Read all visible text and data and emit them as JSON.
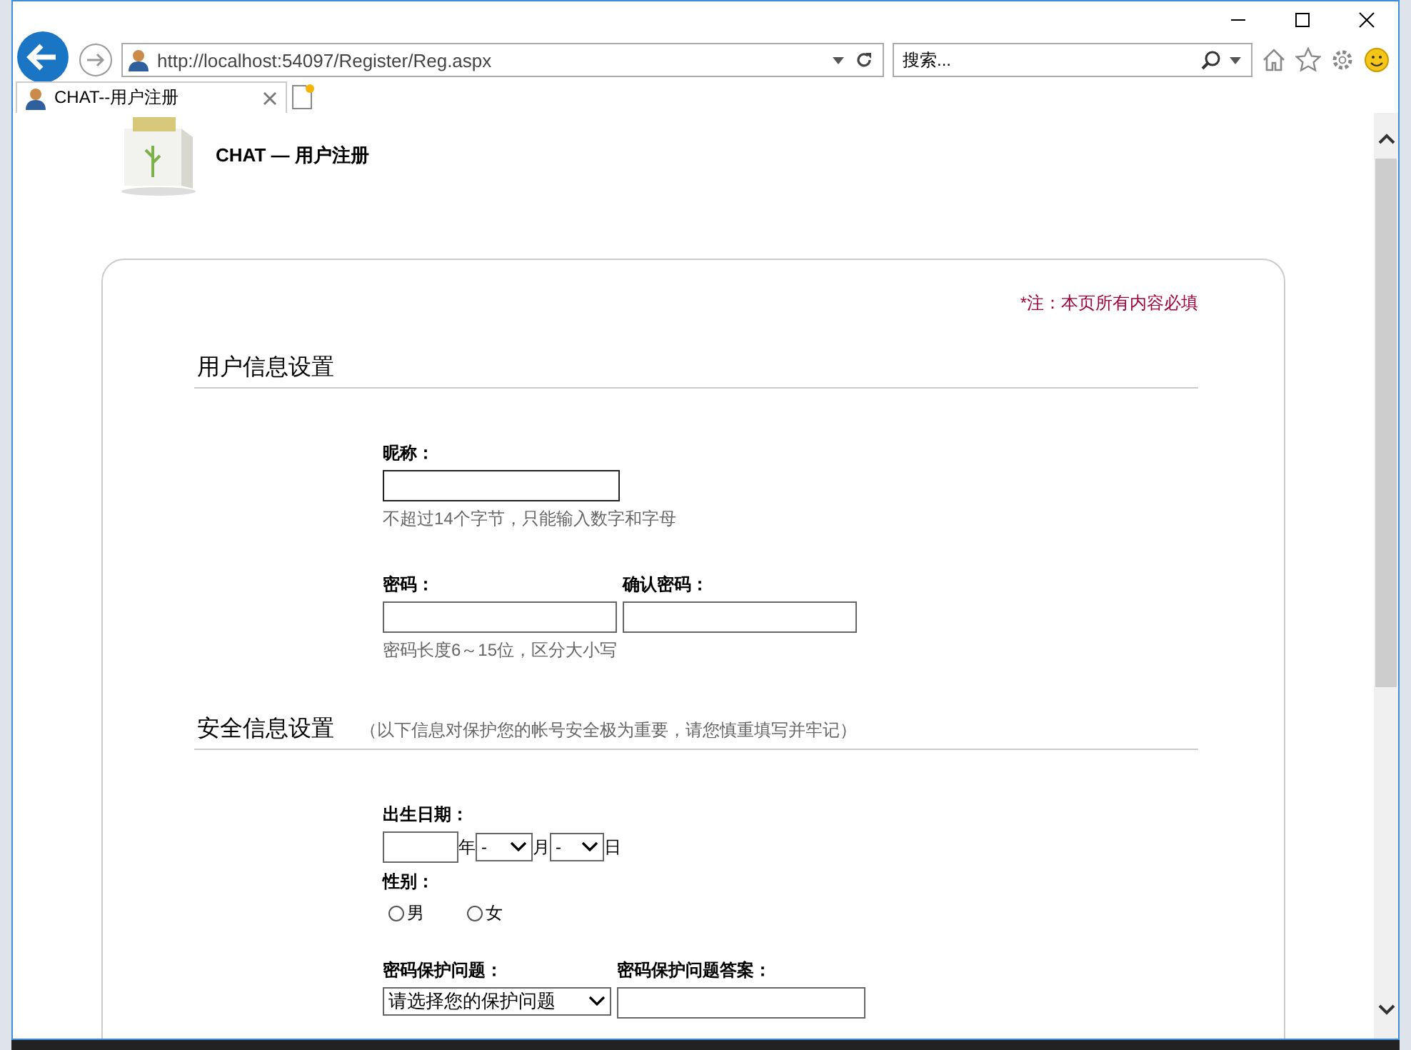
{
  "browser": {
    "url": "http://localhost:54097/Register/Reg.aspx",
    "search_placeholder": "搜索...",
    "tabs": [
      {
        "label": "CHAT--用户注册",
        "selected": true
      }
    ]
  },
  "page": {
    "header_title": "CHAT — 用户注册",
    "required_note": "*注：本页所有内容必填",
    "user_section": {
      "title": "用户信息设置",
      "nickname_label": "昵称：",
      "nickname_focused": true,
      "nickname_hint": "不超过14个字节，只能输入数字和字母",
      "password_label": "密码：",
      "confirm_label": "确认密码：",
      "password_hint": "密码长度6～15位，区分大小写"
    },
    "security_section": {
      "title": "安全信息设置",
      "note": "（以下信息对保护您的帐号安全极为重要，请您慎重填写并牢记）",
      "birth_label": "出生日期：",
      "year_unit": "年",
      "month_value": "-",
      "month_unit": "月",
      "day_value": "-",
      "day_unit": "日",
      "gender_label": "性别：",
      "gender_options": [
        {
          "label": "男",
          "selected": false
        },
        {
          "label": "女",
          "selected": false
        }
      ],
      "question_label": "密码保护问题：",
      "question_value": "请选择您的保护问题",
      "answer_label": "密码保护问题答案："
    }
  }
}
